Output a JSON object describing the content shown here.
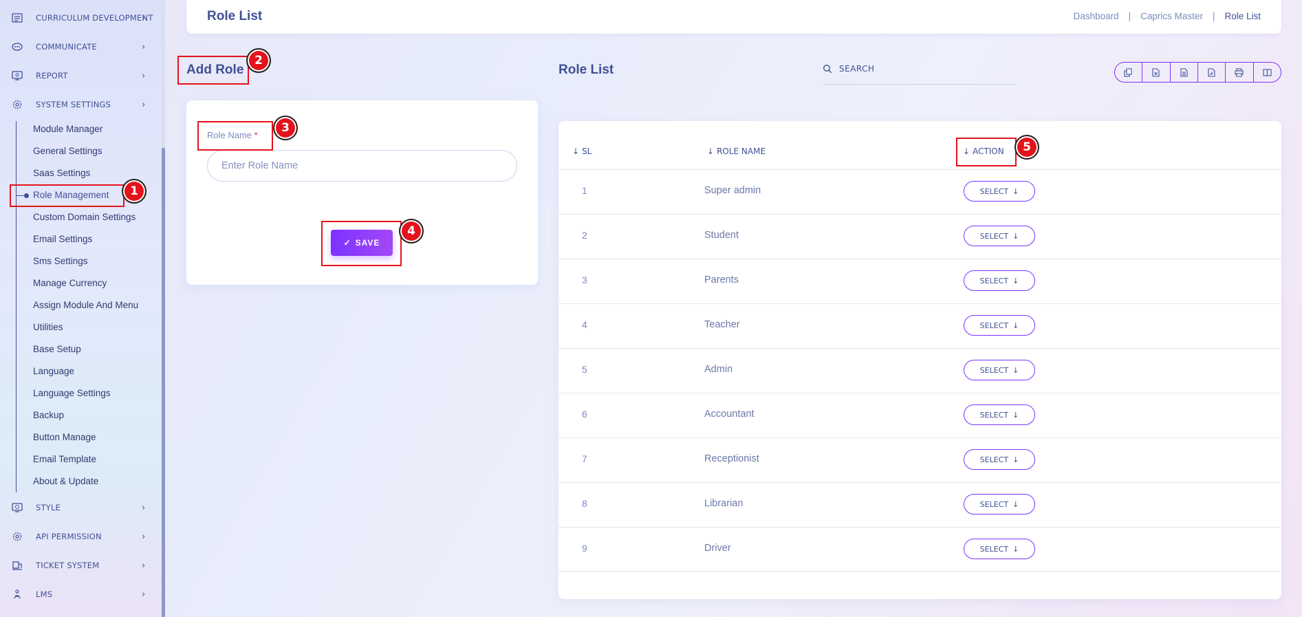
{
  "sidebar": {
    "menus": [
      {
        "label": "CURRICULUM DEVELOPMENT",
        "icon": "curriculum-icon"
      },
      {
        "label": "COMMUNICATE",
        "icon": "communicate-icon"
      },
      {
        "label": "REPORT",
        "icon": "report-icon"
      },
      {
        "label": "SYSTEM SETTINGS",
        "icon": "gear-icon"
      }
    ],
    "sub_items": [
      "Module Manager",
      "General Settings",
      "Saas Settings",
      "Role Management",
      "Custom Domain Settings",
      "Email Settings",
      "Sms Settings",
      "Manage Currency",
      "Assign Module And Menu",
      "Utilities",
      "Base Setup",
      "Language",
      "Language Settings",
      "Backup",
      "Button Manage",
      "Email Template",
      "About & Update"
    ],
    "active_sub": "Role Management",
    "bottom_menus": [
      {
        "label": "STYLE",
        "icon": "style-icon"
      },
      {
        "label": "API PERMISSION",
        "icon": "api-icon"
      },
      {
        "label": "TICKET SYSTEM",
        "icon": "ticket-icon"
      },
      {
        "label": "LMS",
        "icon": "lms-icon"
      }
    ],
    "chevron": "›"
  },
  "header": {
    "title": "Role List",
    "breadcrumbs": [
      "Dashboard",
      "Caprics Master",
      "Role List"
    ],
    "separator": "|"
  },
  "add_role": {
    "heading": "Add Role",
    "field_label": "Role Name",
    "required_mark": "*",
    "placeholder": "Enter Role Name",
    "save_label": "SAVE",
    "save_icon": "✓"
  },
  "role_list": {
    "heading": "Role List",
    "search_placeholder": "SEARCH",
    "export_buttons": [
      "copy-icon",
      "excel-icon",
      "csv-icon",
      "pdf-icon",
      "print-icon",
      "columns-icon"
    ],
    "columns": [
      "SL",
      "ROLE NAME",
      "ACTION"
    ],
    "sort_icon": "↓",
    "rows": [
      {
        "sl": "1",
        "name": "Super admin"
      },
      {
        "sl": "2",
        "name": "Student"
      },
      {
        "sl": "3",
        "name": "Parents"
      },
      {
        "sl": "4",
        "name": "Teacher"
      },
      {
        "sl": "5",
        "name": "Admin"
      },
      {
        "sl": "6",
        "name": "Accountant"
      },
      {
        "sl": "7",
        "name": "Receptionist"
      },
      {
        "sl": "8",
        "name": "Librarian"
      },
      {
        "sl": "9",
        "name": "Driver"
      }
    ],
    "action_label": "SELECT",
    "action_icon": "↓"
  },
  "annotations": [
    "1",
    "2",
    "3",
    "4",
    "5"
  ],
  "colors": {
    "accent": "#7c32ff",
    "text": "#415094",
    "annotation": "#e4121b"
  }
}
